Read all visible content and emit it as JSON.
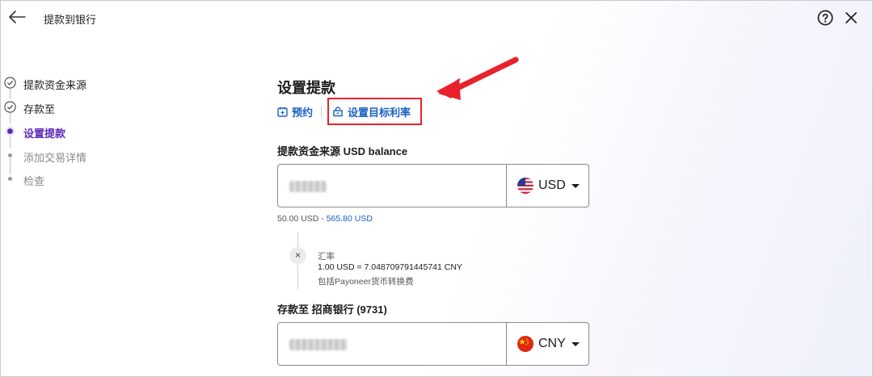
{
  "header": {
    "title": "提款到银行"
  },
  "steps": [
    {
      "label": "提款资金来源",
      "state": "done"
    },
    {
      "label": "存款至",
      "state": "done"
    },
    {
      "label": "设置提款",
      "state": "active"
    },
    {
      "label": "添加交易详情",
      "state": "todo"
    },
    {
      "label": "检查",
      "state": "todo"
    }
  ],
  "main": {
    "title": "设置提款",
    "options": {
      "schedule_label": "预约",
      "target_rate_label": "设置目标利率"
    },
    "source": {
      "label": "提款资金来源 USD balance",
      "currency": "USD",
      "range_min": "50.00 USD",
      "range_sep": " - ",
      "range_max": "565.80 USD"
    },
    "rate": {
      "title": "汇率",
      "value": "1.00 USD = 7.048709791445741 CNY",
      "note": "包括Payoneer货币转换费",
      "operator_icon": "×"
    },
    "destination": {
      "label": "存款至 招商银行 (9731)",
      "currency": "CNY"
    }
  },
  "colors": {
    "accent": "#5b2ab8",
    "link": "#1b5fc6",
    "highlight": "#e8222b"
  }
}
